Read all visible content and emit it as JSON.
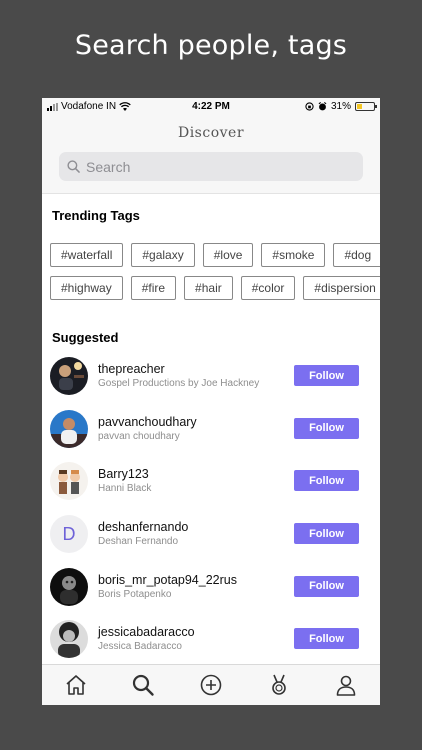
{
  "promo": {
    "title": "Search people, tags"
  },
  "status_bar": {
    "carrier": "Vodafone IN",
    "time": "4:22 PM",
    "battery": "31%",
    "battery_level": 0.31
  },
  "header": {
    "title": "Discover"
  },
  "search": {
    "placeholder": "Search"
  },
  "trending": {
    "title": "Trending Tags",
    "rows": [
      [
        "#waterfall",
        "#galaxy",
        "#love",
        "#smoke",
        "#dog"
      ],
      [
        "#highway",
        "#fire",
        "#hair",
        "#color",
        "#dispersion"
      ]
    ]
  },
  "suggested": {
    "title": "Suggested",
    "users": [
      {
        "username": "thepreacher",
        "fullname": "Gospel Productions by Joe Hackney",
        "avatar": "photo-icon",
        "follow_label": "Follow"
      },
      {
        "username": "pavvanchoudhary",
        "fullname": "pavvan choudhary",
        "avatar": "photo-icon",
        "follow_label": "Follow"
      },
      {
        "username": "Barry123",
        "fullname": "Hanni Black",
        "avatar": "cartoon-icon",
        "follow_label": "Follow"
      },
      {
        "username": "deshanfernando",
        "fullname": "Deshan Fernando",
        "avatar_letter": "D",
        "follow_label": "Follow"
      },
      {
        "username": "boris_mr_potap94_22rus",
        "fullname": "Boris Potapenko",
        "avatar": "photo-icon",
        "follow_label": "Follow"
      },
      {
        "username": "jessicabadaracco",
        "fullname": "Jessica Badaracco",
        "avatar": "photo-icon",
        "follow_label": "Follow"
      }
    ]
  },
  "tabbar": {
    "icons": [
      "home-icon",
      "search-icon",
      "add-icon",
      "medal-icon",
      "profile-icon"
    ]
  },
  "colors": {
    "accent": "#7b6ff0",
    "background": "#4a4a4a"
  }
}
